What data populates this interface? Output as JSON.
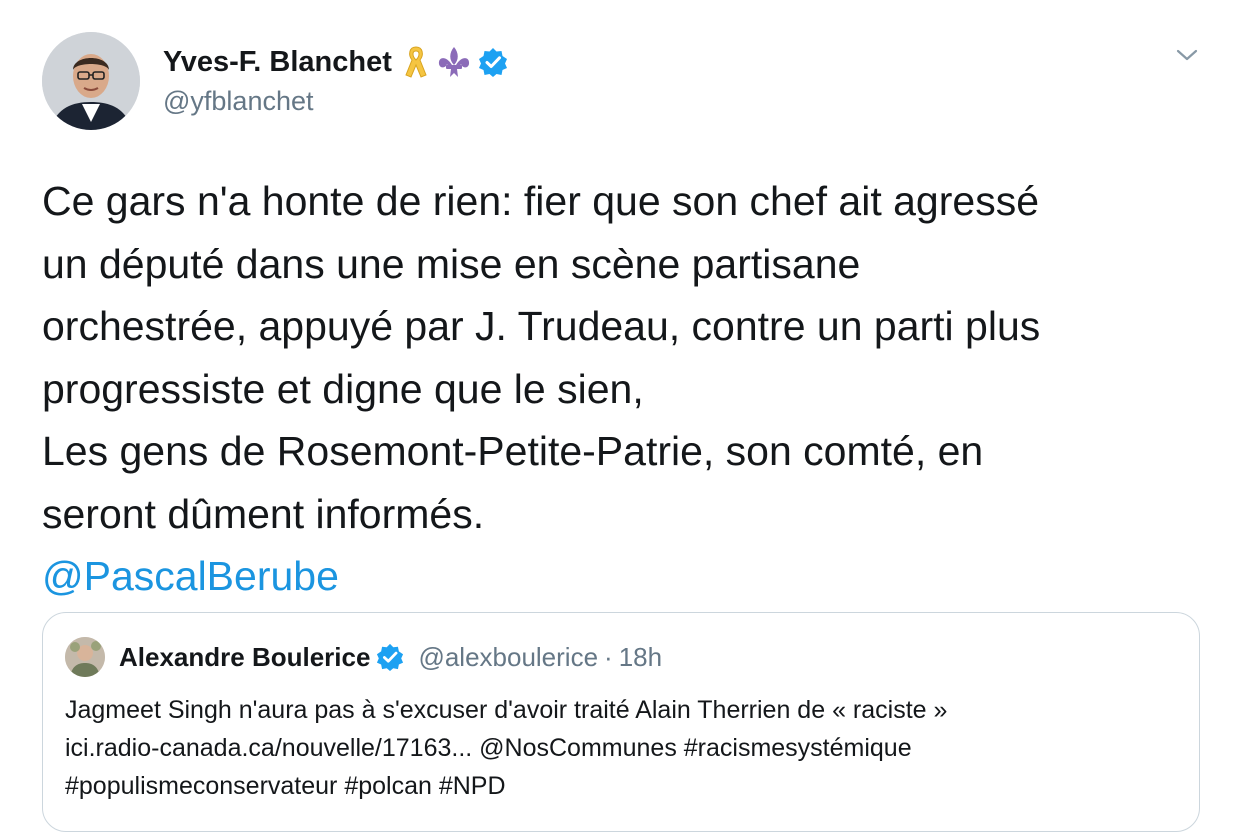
{
  "author": {
    "display_name": "Yves-F. Blanchet",
    "handle": "@yfblanchet"
  },
  "icons": {
    "ribbon": "yellow-ribbon-icon",
    "fleur": "fleur-de-lis-icon",
    "verified": "verified-badge-icon",
    "caret": "chevron-down-icon"
  },
  "colors": {
    "text": "#14171a",
    "secondary": "#657786",
    "link": "#1b95e0",
    "verified": "#1da1f2",
    "ribbon": "#f5c542",
    "fleur": "#8b6bb8",
    "border": "#ccd6dd"
  },
  "tweet": {
    "lines": [
      "Ce gars n'a honte de rien: fier que son chef ait agressé",
      "un député dans une mise en scène partisane",
      "orchestrée, appuyé par J. Trudeau, contre un parti plus",
      "progressiste et digne que le sien,",
      "Les gens de Rosemont-Petite-Patrie, son comté, en",
      "seront dûment informés."
    ],
    "mention": "@PascalBerube"
  },
  "quote": {
    "display_name": "Alexandre Boulerice",
    "handle": "@alexboulerice",
    "separator": "·",
    "time": "18h",
    "lines": [
      "Jagmeet Singh n'aura pas à s'excuser d'avoir traité Alain Therrien de « raciste »",
      "ici.radio-canada.ca/nouvelle/17163... @NosCommunes #racismesystémique",
      "#populismeconservateur #polcan #NPD"
    ]
  }
}
